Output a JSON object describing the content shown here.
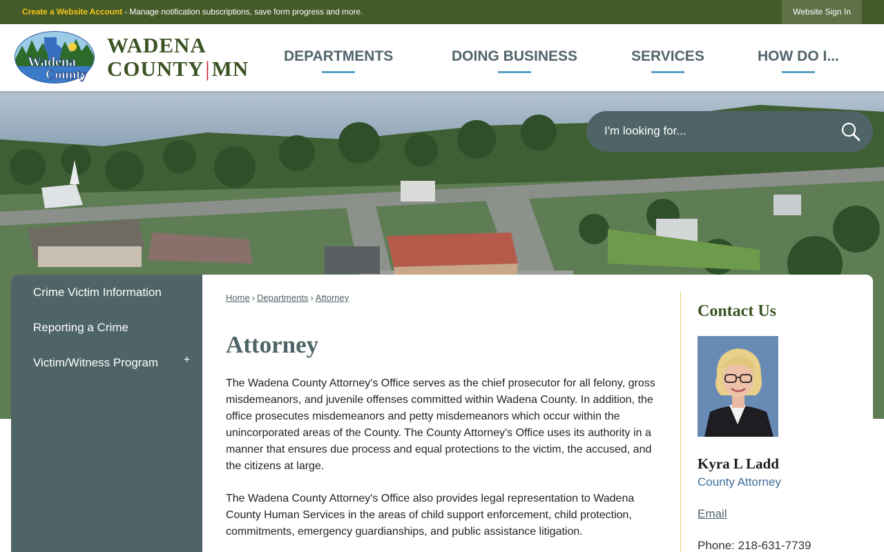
{
  "topbar": {
    "account_link": "Create a Website Account",
    "message": " - Manage notification subscriptions, save form progress and more.",
    "sign_in": "Website Sign In"
  },
  "header": {
    "logo_badge_line1": "Wadena",
    "logo_badge_line2": "County",
    "site_name_line1": "WADENA",
    "site_name_county": "COUNTY",
    "site_name_state": "MN",
    "nav": [
      "DEPARTMENTS",
      "DOING BUSINESS",
      "SERVICES",
      "HOW DO I..."
    ]
  },
  "search": {
    "placeholder": "I'm looking for..."
  },
  "sidebar": {
    "items": [
      {
        "label": "Crime Victim Information"
      },
      {
        "label": "Reporting a Crime"
      },
      {
        "label": "Victim/Witness Program",
        "expand": "+"
      }
    ]
  },
  "breadcrumb": {
    "items": [
      "Home",
      "Departments",
      "Attorney"
    ],
    "separator": "›"
  },
  "page": {
    "title": "Attorney",
    "paragraphs": [
      "The Wadena County Attorney's Office serves as the chief prosecutor for all felony, gross misdemeanors, and juvenile offenses committed within Wadena County. In addition, the office prosecutes misdemeanors and petty misdemeanors which occur within the unincorporated areas of the County.  The County Attorney's Office uses its authority in a manner that ensures due process and equal protections to the victim, the accused, and the citizens at large.",
      "The Wadena County Attorney's Office also provides legal representation to Wadena County Human Services in the areas of child support enforcement, child protection, commitments, emergency guardianships, and public assistance litigation."
    ]
  },
  "contact": {
    "heading": "Contact Us",
    "name": "Kyra L Ladd",
    "role": "County Attorney",
    "email_label": "Email",
    "phone": "Phone: 218-631-7739"
  },
  "colors": {
    "topbar": "#445a28",
    "account_link": "#f3c51b",
    "brand_green": "#3b5323",
    "slate": "#4e6467",
    "nav_underline": "#5b9ec3",
    "link_blue": "#3f6e9a"
  }
}
